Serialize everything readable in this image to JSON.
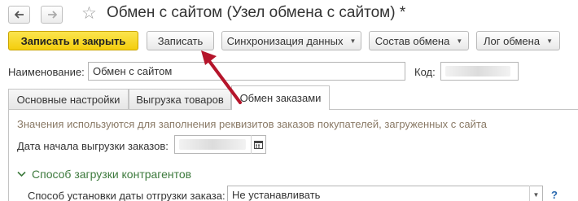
{
  "window": {
    "title": "Обмен с сайтом (Узел обмена с сайтом) *",
    "back_icon": "arrow-left-icon",
    "forward_icon": "arrow-right-icon",
    "favorite_icon": "star-icon"
  },
  "toolbar": {
    "save_close_label": "Записать и закрыть",
    "save_label": "Записать",
    "sync_label": "Синхронизация данных",
    "exchange_composition_label": "Состав обмена",
    "exchange_log_label": "Лог обмена"
  },
  "header": {
    "name_label": "Наименование:",
    "name_value": "Обмен с сайтом",
    "code_label": "Код:"
  },
  "tabs": [
    {
      "label": "Основные настройки"
    },
    {
      "label": "Выгрузка товаров"
    },
    {
      "label": "Обмен заказами"
    }
  ],
  "orders_tab": {
    "hint": "Значения используются для заполнения реквизитов заказов покупателей, загруженных с сайта",
    "start_date_label": "Дата начала выгрузки заказов:",
    "group_title": "Способ загрузки контрагентов",
    "ship_date_label": "Способ установки даты отгрузки заказа:",
    "ship_date_value": "Не устанавливать",
    "help_mark": "?"
  },
  "colors": {
    "primary_button": "#f4cd0d",
    "group_title": "#3d7a3d",
    "hint_text": "#8a7a66",
    "annotation_arrow": "#b5152b"
  }
}
